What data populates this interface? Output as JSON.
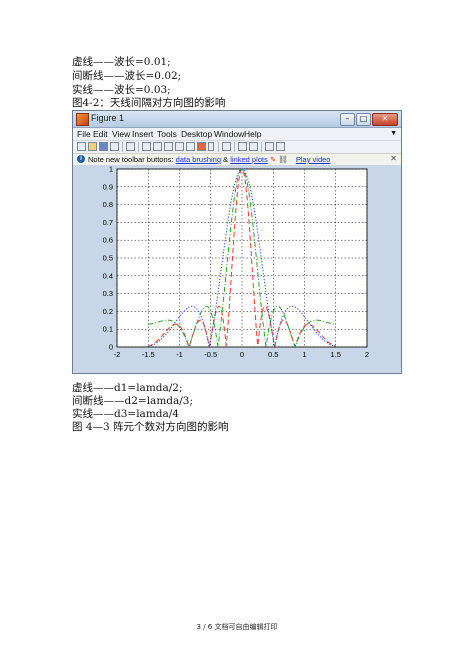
{
  "captions_top": {
    "line1": "虚线——波长=0.01;",
    "line2": "间断线——波长=0.02;",
    "line3": "实线——波长=0.03;",
    "figure_caption": "图4-2：天线间隔对方向图的影响"
  },
  "figure_window": {
    "title": "Figure 1",
    "menu": [
      "File",
      "Edit",
      "View",
      "Insert",
      "Tools",
      "Desktop",
      "Window",
      "Help"
    ],
    "info_text": "Note new toolbar buttons:",
    "info_link1": "data brushing",
    "info_amp": "&",
    "info_link2": "linked plots",
    "info_link3": "Play video"
  },
  "captions_bottom": {
    "line1": "虚线——d1=lamda/2;",
    "line2": "间断线——d2=lamda/3;",
    "line3": "实线——d3=lamda/4",
    "figure_caption": "图 4—3  阵元个数对方向图的影响"
  },
  "footer": "3 / 6 文档可自由编辑打印",
  "chart_data": {
    "type": "line",
    "xlim": [
      -2,
      2
    ],
    "ylim": [
      0,
      1
    ],
    "xticks": [
      "-2",
      "-1.5",
      "-1",
      "-0.5",
      "0",
      "0.5",
      "1",
      "1.5",
      "2"
    ],
    "yticks": [
      "0",
      "0.1",
      "0.2",
      "0.3",
      "0.4",
      "0.5",
      "0.6",
      "0.7",
      "0.8",
      "0.9",
      "1"
    ],
    "grid": true,
    "series": [
      {
        "style": "dashed",
        "color": "#e53935",
        "x_range": [
          -1.5,
          1.5
        ],
        "n": 8,
        "d": 0.5
      },
      {
        "style": "dashdot",
        "color": "#2e9d2e",
        "x_range": [
          -1.5,
          1.5
        ],
        "n": 8,
        "d": 0.333
      },
      {
        "style": "dotted",
        "color": "#1e3fd6",
        "x_range": [
          -1.5,
          1.5
        ],
        "n": 8,
        "d": 0.25
      }
    ]
  }
}
